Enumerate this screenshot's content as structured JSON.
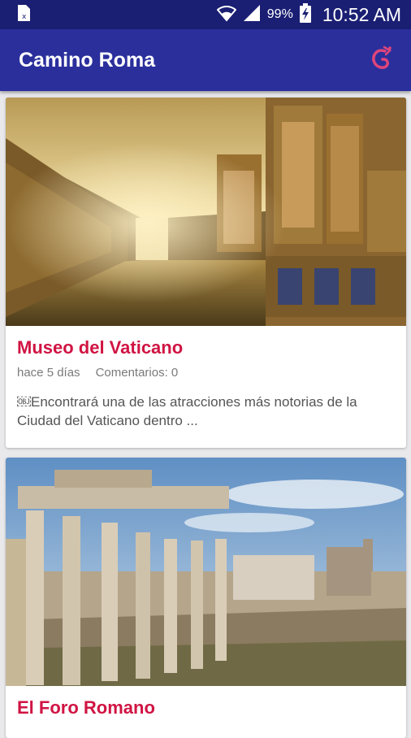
{
  "status_bar": {
    "notification_icon": "sim-card-icon",
    "wifi_icon": "wifi-icon",
    "signal_icon": "signal-icon",
    "battery_percent": "99%",
    "battery_icon": "battery-charging-icon",
    "time": "10:52 AM"
  },
  "app_bar": {
    "title": "Camino Roma",
    "action_icon": "share-swirl-icon",
    "accent_color": "#e0457b",
    "background_color": "#2b2f9c"
  },
  "articles": [
    {
      "title": "Museo del Vaticano",
      "time_ago": "hace 5 días",
      "comments": "Comentarios: 0",
      "excerpt": "￼Encontrará una de las atracciones más notorias de la Ciudad del Vaticano dentro ...",
      "image_label": "vatican-gallery-photo"
    },
    {
      "title": "El Foro Romano",
      "image_label": "roman-forum-photo"
    }
  ],
  "colors": {
    "title_red": "#d01443",
    "status_bar": "#1a1f73"
  }
}
